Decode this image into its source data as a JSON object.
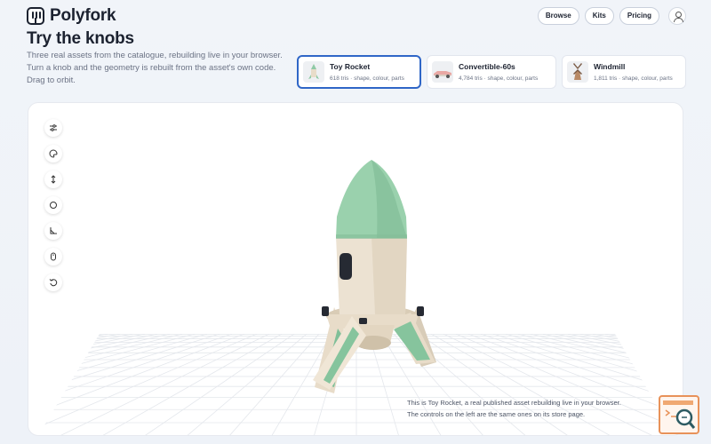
{
  "brand": {
    "name": "Polyfork"
  },
  "nav": {
    "browse": "Browse",
    "kits": "Kits",
    "pricing": "Pricing"
  },
  "hero": {
    "title": "Try the knobs",
    "description": "Three real assets from the catalogue, rebuilding live in your browser. Turn a knob and the geometry is rebuilt from the asset's own code. Drag to orbit."
  },
  "assets": [
    {
      "name": "Toy Rocket",
      "meta": "618 tris · shape, colour, parts",
      "selected": true
    },
    {
      "name": "Convertible-60s",
      "meta": "4,784 tris · shape, colour, parts",
      "selected": false
    },
    {
      "name": "Windmill",
      "meta": "1,811 tris · shape, colour, parts",
      "selected": false
    }
  ],
  "viewer": {
    "tools": [
      "sliders-icon",
      "palette-icon",
      "resize-vertical-icon",
      "circle-icon",
      "angle-icon",
      "mouse-icon",
      "reset-icon"
    ],
    "caption_line1": "This is Toy Rocket, a real published asset rebuilding live in your browser.",
    "caption_line2": "The controls on the left are the same ones on its store page."
  },
  "colors": {
    "accent": "#2f66c7",
    "rocket_nose": "#8fcaa6",
    "rocket_body": "#e8dcc9"
  }
}
